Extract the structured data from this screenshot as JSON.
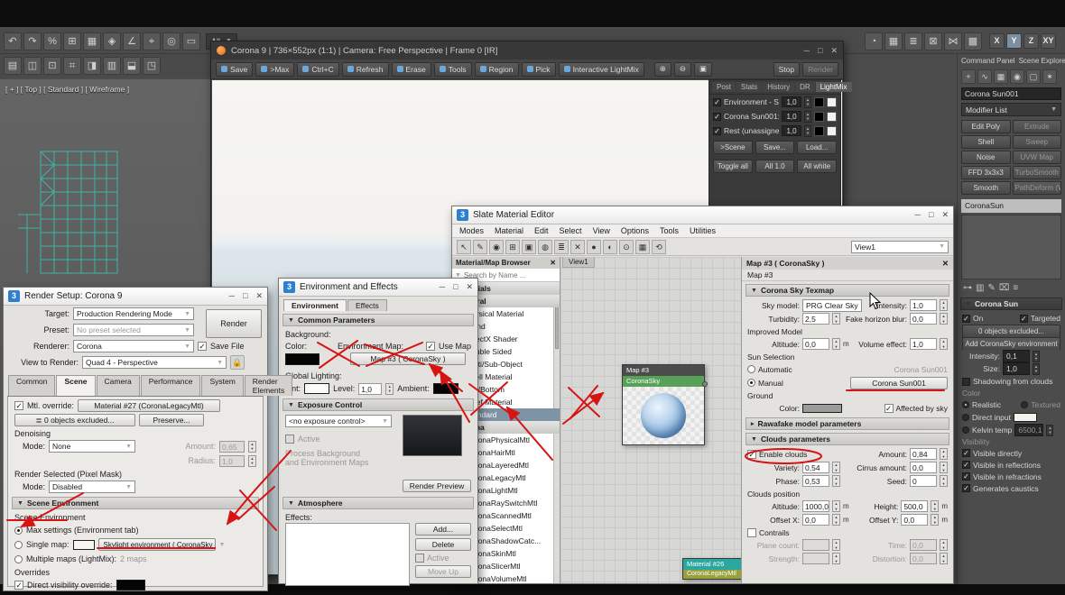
{
  "viewport": {
    "label": "[ + ]  [ Top ]  [ Standard ]  [ Wireframe ]"
  },
  "toolbar": {
    "row1": [
      "↶",
      "↷",
      "%",
      "⊞",
      "▦",
      "◈",
      "∠",
      "⌖",
      "◎",
      "▭"
    ],
    "row2": [
      "▤",
      "◫",
      "⊡",
      "⌗",
      "◨",
      "▥",
      "⬓",
      "◳"
    ],
    "selection_filter": "All",
    "right_icons": [
      "◔",
      "▦",
      "≣",
      "⊠",
      "⋈",
      "▩"
    ],
    "axis": [
      "X",
      "Y",
      "Z",
      "XY"
    ]
  },
  "command_panel": {
    "header_left": "Command Panel",
    "header_right": "Scene Explorer",
    "tab_icons": [
      "+",
      "∿",
      "▦",
      "◉",
      "▢",
      "✶"
    ],
    "object_name": "Corona Sun001",
    "modifier_list_label": "Modifier List",
    "modifier_buttons": [
      {
        "label": "Edit Poly",
        "state": "on"
      },
      {
        "label": "Extrude",
        "state": "off"
      },
      {
        "label": "Shell",
        "state": "on"
      },
      {
        "label": "Sweep",
        "state": "off"
      },
      {
        "label": "Noise",
        "state": "on"
      },
      {
        "label": "UVW Map",
        "state": "off"
      },
      {
        "label": "FFD 3x3x3",
        "state": "on"
      },
      {
        "label": "TurboSmooth",
        "state": "off"
      },
      {
        "label": "Smooth",
        "state": "on"
      },
      {
        "label": "PathDeform (WSM",
        "state": "off"
      }
    ],
    "stack_selection": "CoronaSun",
    "stack_icons": [
      "⊶",
      "▥",
      "✎",
      "⌧",
      "≡"
    ],
    "corona_sun": {
      "title": "Corona Sun",
      "on_label": "On",
      "targeted_label": "Targeted",
      "excluded_button": "0 objects excluded...",
      "add_env_button": "Add CoronaSky environment",
      "intensity_label": "Intensity:",
      "intensity": "0,1",
      "size_label": "Size:",
      "size": "1,0",
      "shadowing_label": "Shadowing from clouds",
      "color_label": "Color",
      "realistic_label": "Realistic",
      "textured_label": "Textured",
      "direct_input_label": "Direct input",
      "kelvin_label": "Kelvin temp",
      "kelvin": "6500,1",
      "visibility_label": "Visibility",
      "visibility_items": [
        "Visible directly",
        "Visible in reflections",
        "Visible in refractions",
        "Generates caustics"
      ]
    }
  },
  "vfb": {
    "title": "Corona 9 | 736×552px (1:1) | Camera: Free Perspective | Frame 0 [IR]",
    "buttons": [
      "Save",
      ">Max",
      "Ctrl+C",
      "Refresh",
      "Erase",
      "Tools",
      "Region",
      "Pick",
      "Interactive LightMix"
    ],
    "zoom_icons": [
      "⊕",
      "⊖",
      "▣"
    ],
    "stop_button": "Stop",
    "render_button": "Render",
    "lightmix": {
      "tabs": [
        "Post",
        "Stats",
        "History",
        "DR",
        "LightMix"
      ],
      "rows": [
        {
          "label": "Environment - Skylight",
          "value": "1,0"
        },
        {
          "label": "Corona Sun001:",
          "value": "1,0"
        },
        {
          "label": "Rest (unassigned):",
          "value": "1,0"
        }
      ],
      "row_buttons": [
        ">Scene",
        "Save...",
        "Load..."
      ],
      "bottom_buttons": [
        "Toggle all",
        "All 1.0",
        "All white"
      ]
    }
  },
  "render_setup": {
    "title": "Render Setup: Corona 9",
    "target_label": "Target:",
    "target_value": "Production Rendering Mode",
    "preset_label": "Preset:",
    "preset_value": "No preset selected",
    "renderer_label": "Renderer:",
    "renderer_value": "Corona",
    "save_file_label": "Save File",
    "render_button": "Render",
    "view_label": "View to Render:",
    "view_value": "Quad 4 - Perspective",
    "tabs": [
      "Common",
      "Scene",
      "Camera",
      "Performance",
      "System",
      "Render Elements"
    ],
    "mtl_override_label": "Mtl. override:",
    "mtl_override_value": "Material #27 (CoronaLegacyMtl)",
    "excluded_button": "0 objects excluded...",
    "preserve_button": "Preserve...",
    "denoising_label": "Denoising",
    "mode_label": "Mode:",
    "denoise_mode": "None",
    "amount_label": "Amount:",
    "amount": "0,65",
    "radius_label": "Radius:",
    "radius": "1,0",
    "render_selected_label": "Render Selected (Pixel Mask)",
    "rs_mode": "Disabled",
    "scene_env_rollout": "Scene Environment",
    "scene_env_label": "Scene Environment",
    "max_settings_label": "Max settings (Environment tab)",
    "single_map_label": "Single map:",
    "skylight_button": "Skylight environment ( CoronaSky )",
    "multiple_maps_label": "Multiple maps (LightMix):",
    "multiple_maps_value": "2 maps",
    "overrides_label": "Overrides",
    "direct_visibility_label": "Direct visibility override:"
  },
  "environment": {
    "title": "Environment and Effects",
    "tabs": [
      "Environment",
      "Effects"
    ],
    "common_params": "Common Parameters",
    "background_label": "Background:",
    "color_label": "Color:",
    "env_map_label": "Environment Map:",
    "use_map_label": "Use Map",
    "map_button": "Map #3 ( CoronaSky )",
    "global_lighting_label": "Global Lighting:",
    "tint_label": "Tint:",
    "level_label": "Level:",
    "level": "1,0",
    "ambient_label": "Ambient:",
    "exposure_rollout": "Exposure Control",
    "exposure_value": "<no exposure control>",
    "active_label": "Active",
    "process_label1": "Process Background",
    "process_label2": "and Environment Maps",
    "render_preview_button": "Render Preview",
    "atmosphere_rollout": "Atmosphere",
    "effects_label": "Effects:",
    "buttons": [
      "Add...",
      "Delete",
      "Active",
      "Move Up"
    ]
  },
  "slate": {
    "title": "Slate Material Editor",
    "menus": [
      "Modes",
      "Material",
      "Edit",
      "Select",
      "View",
      "Options",
      "Tools",
      "Utilities"
    ],
    "toolbar_icons": [
      "↖",
      "✎",
      "◉",
      "⊞",
      "▣",
      "◍",
      "≣",
      "✕",
      "●",
      "◐",
      "⊙",
      "▦",
      "⟲"
    ],
    "view_dropdown": "View1",
    "view_tab": "View1",
    "browser_title": "Material/Map Browser",
    "search_placeholder": "Search by Name ...",
    "browser_items": [
      {
        "t": "g",
        "label": "Materials"
      },
      {
        "t": "g",
        "label": "General"
      },
      {
        "t": "i",
        "label": "Physical Material"
      },
      {
        "t": "i",
        "label": "Blend"
      },
      {
        "t": "i",
        "label": "DirectX Shader"
      },
      {
        "t": "i",
        "label": "Double Sided"
      },
      {
        "t": "i",
        "label": "Multi/Sub-Object"
      },
      {
        "t": "i",
        "label": "Shell Material"
      },
      {
        "t": "i",
        "label": "Top/Bottom"
      },
      {
        "t": "i",
        "label": "XRef Material"
      },
      {
        "t": "sel",
        "label": "Standard"
      },
      {
        "t": "g",
        "label": "Corona"
      },
      {
        "t": "i",
        "label": "CoronaPhysicalMtl"
      },
      {
        "t": "i",
        "label": "CoronaHairMtl"
      },
      {
        "t": "i",
        "label": "CoronaLayeredMtl"
      },
      {
        "t": "i",
        "label": "CoronaLegacyMtl"
      },
      {
        "t": "i",
        "label": "CoronaLightMtl"
      },
      {
        "t": "i",
        "label": "CoronaRaySwitchMtl"
      },
      {
        "t": "i",
        "label": "CoronaScannedMtl"
      },
      {
        "t": "i",
        "label": "CoronaSelectMtl"
      },
      {
        "t": "i",
        "label": "CoronaShadowCatc..."
      },
      {
        "t": "i",
        "label": "CoronaSkinMtl"
      },
      {
        "t": "i",
        "label": "CoronaSlicerMtl"
      },
      {
        "t": "i",
        "label": "CoronaVolumeMtl"
      }
    ],
    "node1": {
      "title": "Map #3",
      "subtitle": "CoronaSky"
    },
    "node2": {
      "title": "Material #26",
      "subtitle": "CoronaLegacyMtl"
    },
    "params": {
      "header": "Map #3 ( CoronaSky )",
      "name": "Map #3",
      "rollout1": "Corona Sky Texmap",
      "sky_model_label": "Sky model:",
      "sky_model": "PRG Clear Sky",
      "intensity_label": "Intensity:",
      "intensity": "1,0",
      "turbidity_label": "Turbidity:",
      "turbidity": "2,5",
      "fake_horizon_label": "Fake horizon blur:",
      "fake_horizon": "0,0",
      "improved_model_label": "Improved Model",
      "altitude_label": "Altitude:",
      "altitude": "0,0",
      "meters": "m",
      "volume_label": "Volume effect:",
      "volume": "1,0",
      "sun_selection_label": "Sun Selection",
      "automatic_label": "Automatic",
      "automatic_value": "Corona Sun001",
      "manual_label": "Manual",
      "manual_value": "Corona Sun001",
      "ground_label": "Ground",
      "color_label": "Color:",
      "affected_label": "Affected by sky",
      "rollout2": "Rawafake model parameters",
      "rollout3": "Clouds parameters",
      "enable_clouds_label": "Enable clouds",
      "amount_label": "Amount:",
      "amount": "0,84",
      "variety_label": "Variety:",
      "variety": "0,54",
      "cirrus_label": "Cirrus amount:",
      "cirrus": "0,0",
      "phase_label": "Phase:",
      "phase": "0,53",
      "seed_label": "Seed:",
      "seed": "0",
      "clouds_position_label": "Clouds position",
      "calt_label": "Altitude:",
      "calt": "1000,0",
      "height_label": "Height:",
      "height": "500,0",
      "offx_label": "Offset X:",
      "offx": "0,0",
      "offy_label": "Offset Y:",
      "offy": "0,0",
      "contrails_label": "Contrails",
      "plane_label": "Plane count:",
      "plane": "",
      "time_label": "Time:",
      "time": "0,0",
      "strength_label": "Strength:",
      "strength": "",
      "distortion_label": "Distortion:",
      "distortion": "0,0"
    }
  }
}
